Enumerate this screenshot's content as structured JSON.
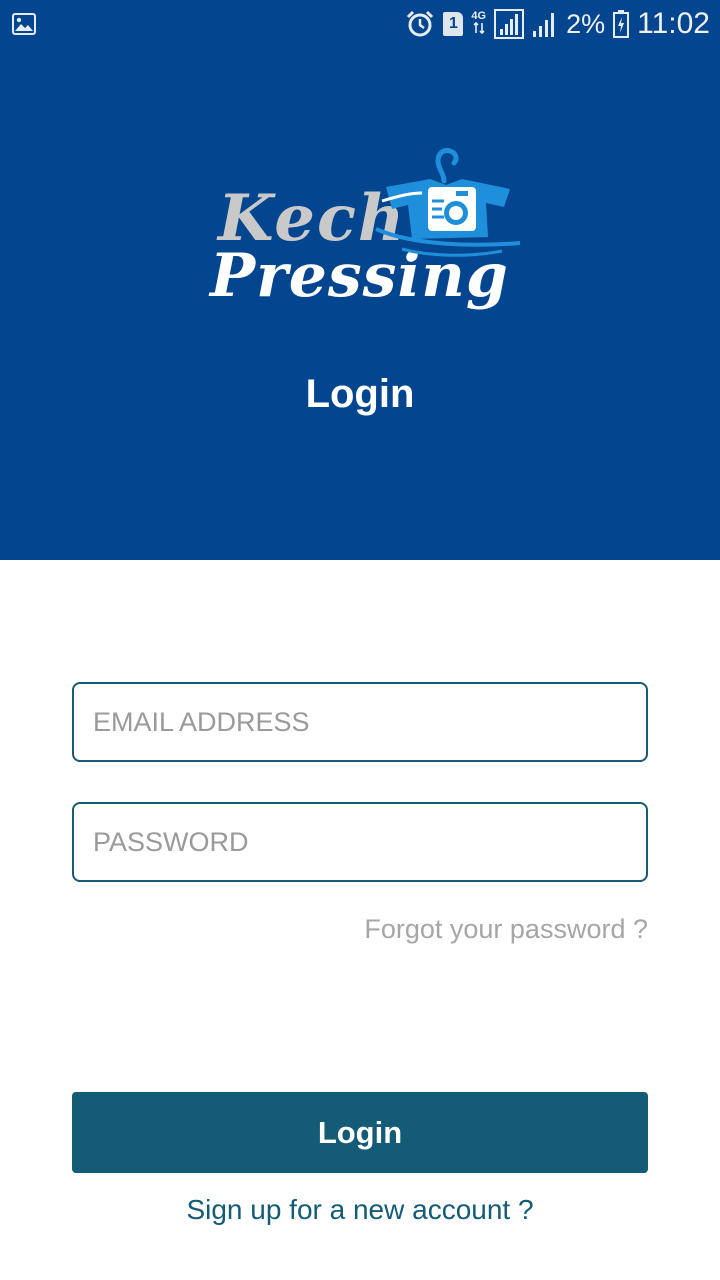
{
  "status_bar": {
    "sim_slot": "1",
    "network_type": "4G",
    "battery": "2%",
    "time": "11:02",
    "icons": [
      "gallery-icon",
      "alarm-icon",
      "sim-icon",
      "data-arrows-icon",
      "signal-icon",
      "signal-icon",
      "battery-icon"
    ]
  },
  "logo": {
    "line1": "Kech",
    "line2": "Pressing",
    "colors": {
      "kech": "#c9c9c9",
      "pressing": "#ffffff",
      "icon": "#1f8fdc"
    }
  },
  "header": {
    "title": "Login",
    "background": "#03468f"
  },
  "form": {
    "email_placeholder": "EMAIL ADDRESS",
    "email_value": "",
    "password_placeholder": "PASSWORD",
    "password_value": "",
    "forgot_label": "Forgot your password ?",
    "login_label": "Login",
    "signup_label": "Sign up for a new account ?"
  },
  "colors": {
    "accent": "#135b76",
    "muted": "#a6a6a6"
  }
}
